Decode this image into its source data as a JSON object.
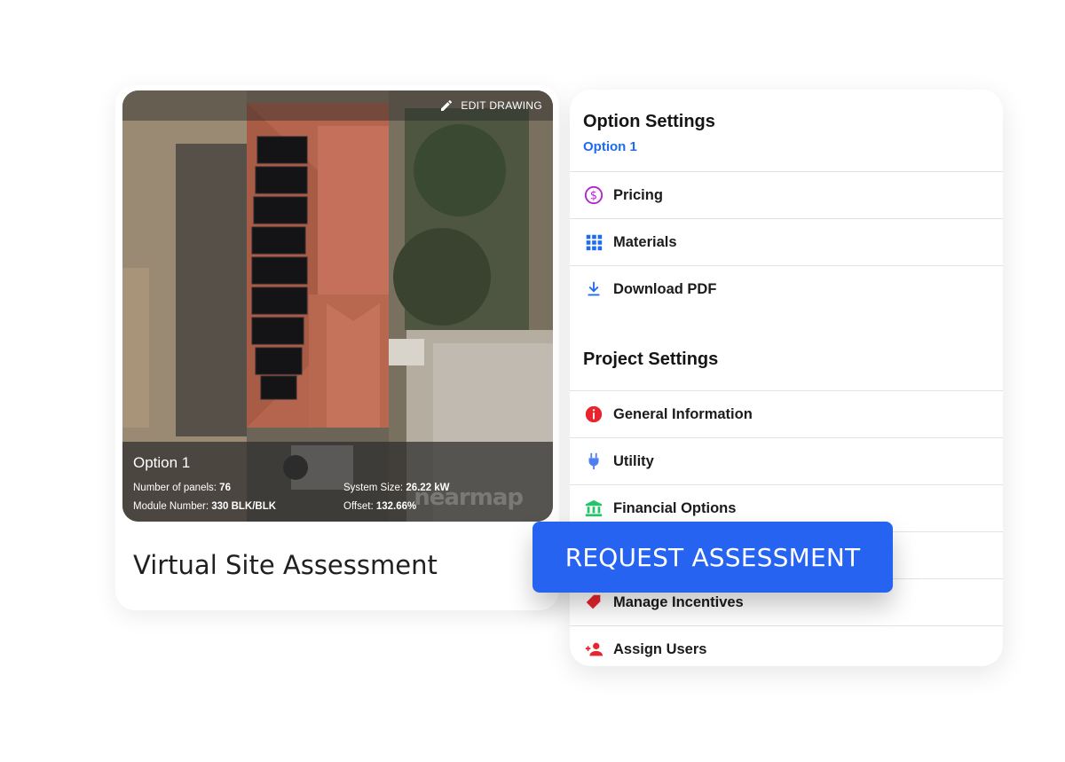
{
  "left_card": {
    "edit_label": "EDIT DRAWING",
    "option_title": "Option 1",
    "panels_label": "Number of panels:",
    "panels_value": "76",
    "module_label": "Module Number:",
    "module_value": "330 BLK/BLK",
    "size_label": "System Size:",
    "size_value": "26.22 kW",
    "offset_label": "Offset:",
    "offset_value": "132.66%",
    "watermark": "nearmap",
    "caption": "Virtual Site Assessment"
  },
  "panel": {
    "option_settings_title": "Option Settings",
    "option_subtitle": "Option 1",
    "option_items": [
      {
        "label": "Pricing",
        "icon": "dollar-circle-icon"
      },
      {
        "label": "Materials",
        "icon": "grid-icon"
      },
      {
        "label": "Download PDF",
        "icon": "download-icon"
      }
    ],
    "project_settings_title": "Project Settings",
    "project_items": [
      {
        "label": "General Information",
        "icon": "info-icon"
      },
      {
        "label": "Utility",
        "icon": "plug-icon"
      },
      {
        "label": "Financial Options",
        "icon": "bank-icon"
      },
      {
        "label": "",
        "icon": ""
      },
      {
        "label": "Manage Incentives",
        "icon": "tag-icon"
      },
      {
        "label": "Assign Users",
        "icon": "add-user-icon"
      }
    ]
  },
  "request_button": "REQUEST ASSESSMENT",
  "colors": {
    "accent": "#2563f0",
    "link": "#1f6bf0",
    "pricing_icon": "#b41fd6",
    "info_icon": "#e8242e",
    "finance_icon": "#25c46a"
  }
}
